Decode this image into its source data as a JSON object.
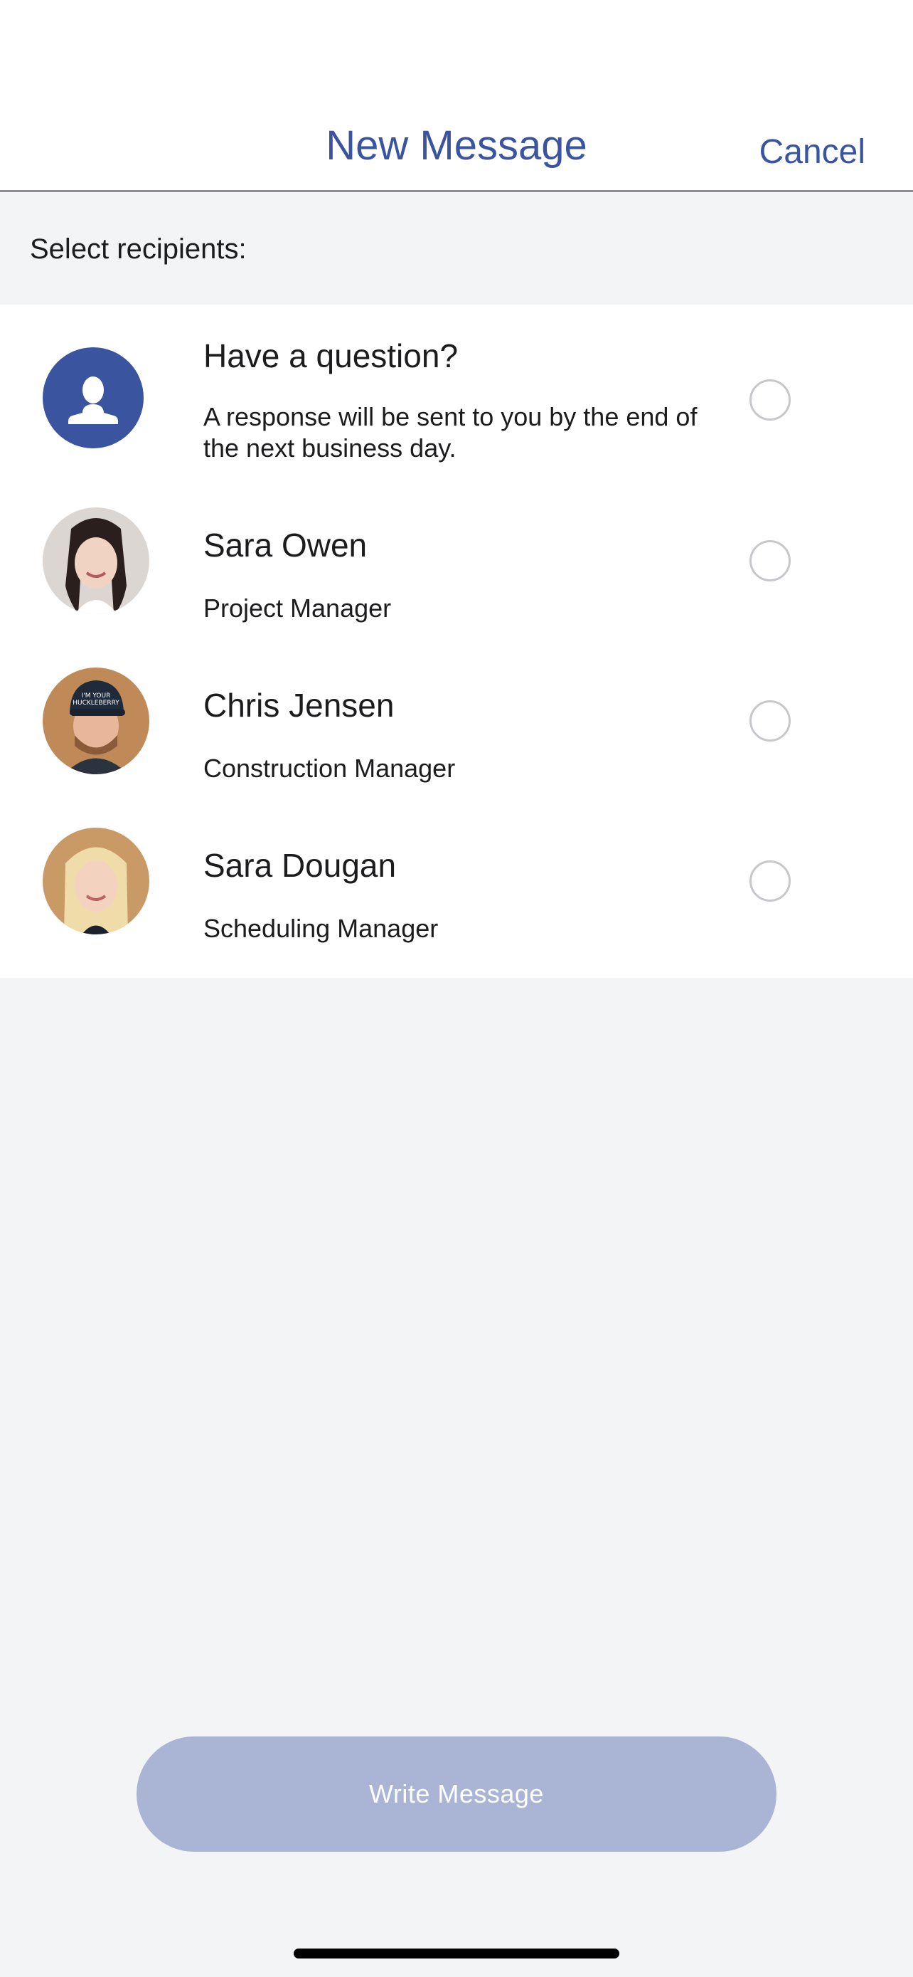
{
  "header": {
    "title": "New Message",
    "cancel_label": "Cancel"
  },
  "section_label": "Select recipients:",
  "recipients": [
    {
      "title": "Have a question?",
      "subtitle": "A response will be sent to you by the end of the next business day.",
      "avatar": "generic-person-icon",
      "selected": false
    },
    {
      "title": "Sara Owen",
      "subtitle": "Project Manager",
      "avatar": "photo",
      "selected": false
    },
    {
      "title": "Chris Jensen",
      "subtitle": "Construction Manager",
      "avatar": "photo",
      "selected": false
    },
    {
      "title": "Sara Dougan",
      "subtitle": "Scheduling Manager",
      "avatar": "photo",
      "selected": false
    }
  ],
  "write_button_label": "Write Message",
  "colors": {
    "accent": "#3b54a0",
    "button_disabled": "#aab5d6",
    "background": "#f3f4f6"
  }
}
